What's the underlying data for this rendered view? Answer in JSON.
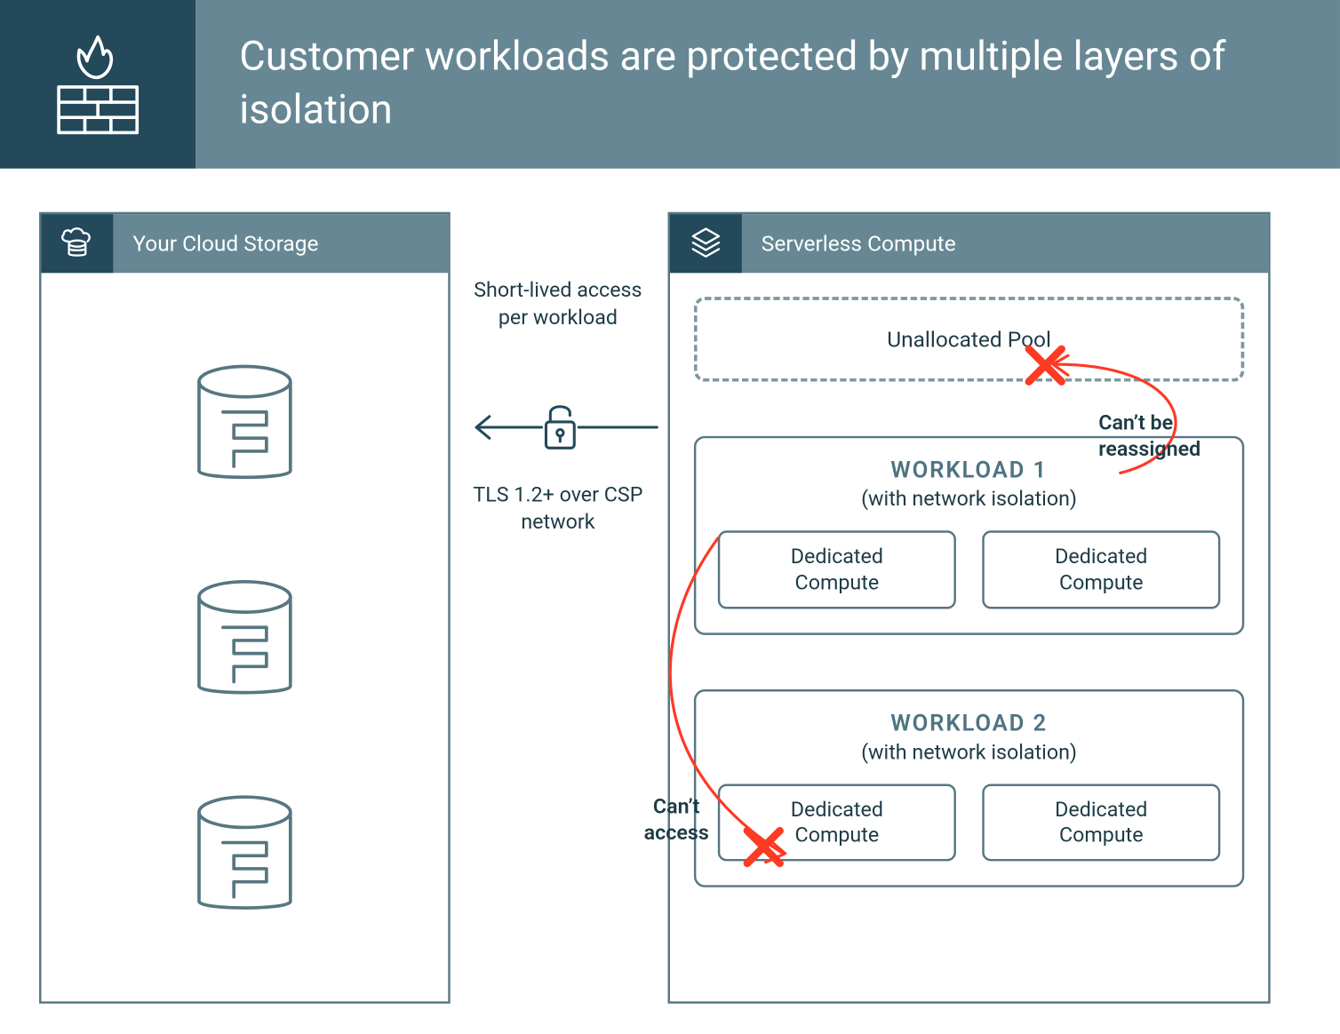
{
  "header": {
    "title": "Customer workloads are protected by multiple layers of isolation"
  },
  "left_panel": {
    "title": "Your Cloud Storage"
  },
  "right_panel": {
    "title": "Serverless Compute",
    "pool_label": "Unallocated Pool",
    "workloads": [
      {
        "title": "WORKLOAD 1",
        "subtitle": "(with network isolation)",
        "compute": [
          "Dedicated Compute",
          "Dedicated Compute"
        ]
      },
      {
        "title": "WORKLOAD 2",
        "subtitle": "(with network isolation)",
        "compute": [
          "Dedicated Compute",
          "Dedicated Compute"
        ]
      }
    ]
  },
  "middle": {
    "top_label": "Short-lived access per workload",
    "bottom_label": "TLS 1.2+ over CSP network"
  },
  "annotations": {
    "cant_reassign": "Can’t be reassigned",
    "cant_access": "Can’t access"
  },
  "colors": {
    "dark": "#23495a",
    "mid": "#668793",
    "border": "#577682",
    "accent_red": "#fd3a24"
  }
}
